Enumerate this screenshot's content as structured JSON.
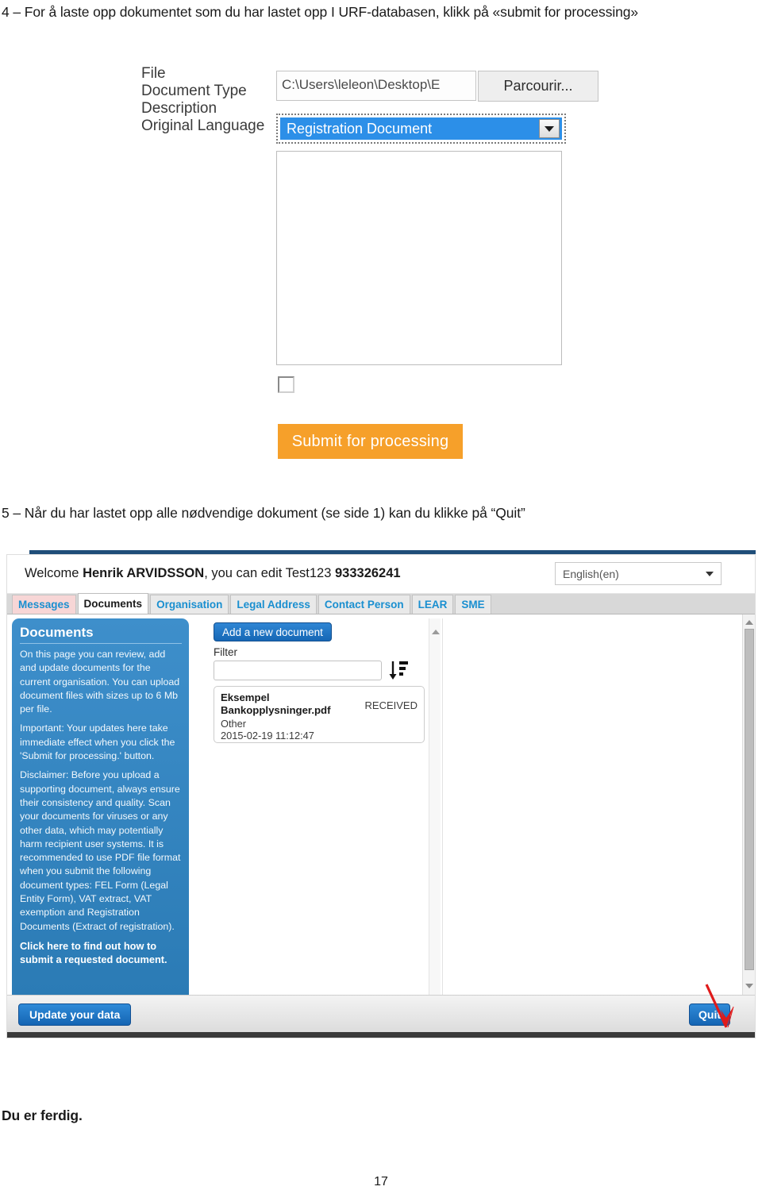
{
  "document": {
    "step4": "4 – For å laste opp dokumentet som du har lastet opp I URF-databasen, klikk på «submit for processing»",
    "step5": "5 – Når du har lastet opp alle nødvendige dokument (se side 1) kan du klikke på “Quit”",
    "closing": "Du er ferdig.",
    "page_number": "17"
  },
  "upload_form": {
    "file_label": "File",
    "file_value": "C:\\Users\\leleon\\Desktop\\E",
    "browse_button": "Parcourir...",
    "document_type_label": "Document Type",
    "document_type_value": "Registration Document",
    "description_label": "Description",
    "description_value": "",
    "original_language_label": "Original Language",
    "submit_button": "Submit for processing"
  },
  "portal": {
    "welcome": {
      "prefix": "Welcome ",
      "user": "Henrik ARVIDSSON",
      "middle": ", you can edit Test123 ",
      "org_id": "933326241"
    },
    "language_select": "English(en)",
    "tabs": [
      {
        "label": "Messages",
        "state": "unread"
      },
      {
        "label": "Documents",
        "state": "active"
      },
      {
        "label": "Organisation",
        "state": "normal"
      },
      {
        "label": "Legal Address",
        "state": "normal"
      },
      {
        "label": "Contact Person",
        "state": "normal"
      },
      {
        "label": "LEAR",
        "state": "normal"
      },
      {
        "label": "SME",
        "state": "normal"
      }
    ],
    "info_panel": {
      "title": "Documents",
      "paragraphs": [
        "On this page you can review, add and update documents for the current organisation. You can upload document files with sizes up to 6 Mb per file.",
        "Important: Your updates here take immediate effect when you click the 'Submit for processing.' button.",
        "Disclaimer: Before you upload a supporting document, always ensure their consistency and quality. Scan your documents for viruses or any other data, which may potentially harm recipient user systems. It is recommended to use PDF file format when you submit the following document types: FEL Form (Legal Entity Form), VAT extract, VAT exemption and Registration Documents (Extract of registration)."
      ],
      "link": "Click here to find out how to submit a requested document."
    },
    "documents": {
      "add_button": "Add a new document",
      "filter_label": "Filter",
      "filter_value": "",
      "sort_icon": "sort-descending-icon",
      "items": [
        {
          "name": "Eksempel Bankopplysninger.pdf",
          "status": "RECEIVED",
          "type": "Other",
          "date": "2015-02-19 11:12:47"
        }
      ]
    },
    "footer": {
      "update_button": "Update your data",
      "quit_button": "Quit"
    }
  },
  "colors": {
    "submit_orange": "#f6a02a",
    "info_panel_blue": "#3e8fcb",
    "button_blue": "#1667b5",
    "tab_link_blue": "#1a8fd0",
    "messages_tab_pink": "#f7d6d6",
    "select_highlight": "#2c8fe8",
    "annotation_red": "#e01b1b",
    "top_band": "#1f4e79"
  }
}
